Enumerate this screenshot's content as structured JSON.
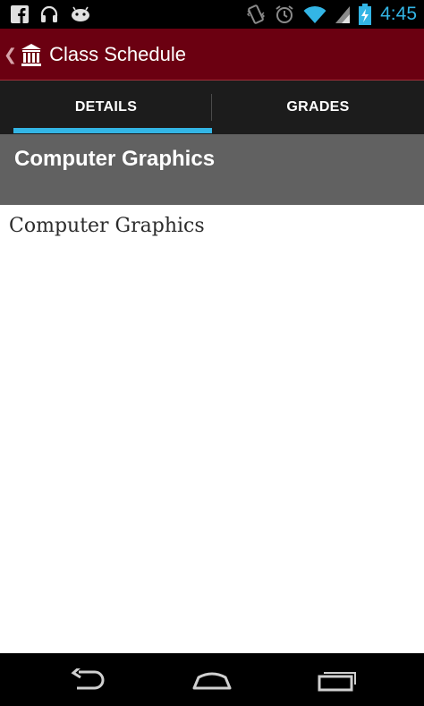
{
  "status_bar": {
    "time": "4:45",
    "left_icons": [
      "facebook-icon",
      "headset-icon",
      "android-icon"
    ],
    "right_icons": [
      "vibrate-icon",
      "alarm-icon",
      "wifi-icon",
      "signal-icon",
      "battery-charging-icon"
    ],
    "clock_color": "#33b5e5"
  },
  "action_bar": {
    "title": "Class Schedule",
    "app_icon": "building-icon",
    "background": "#6b0011"
  },
  "tabs": [
    {
      "label": "DETAILS",
      "selected": true
    },
    {
      "label": "GRADES",
      "selected": false
    }
  ],
  "tab_indicator_color": "#33b5e5",
  "course": {
    "header_title": "Computer Graphics",
    "body_title": "Computer Graphics"
  },
  "nav_bar": {
    "buttons": [
      "back-icon",
      "home-icon",
      "recent-apps-icon"
    ]
  }
}
